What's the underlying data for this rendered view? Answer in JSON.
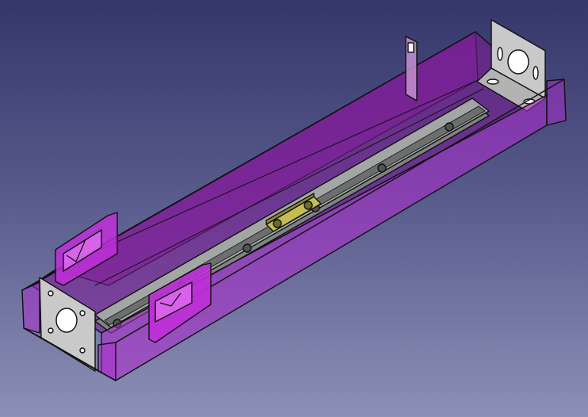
{
  "viewport": {
    "background_top": "#35366a",
    "background_bottom": "#8c8fb6"
  },
  "model": {
    "channel_color": "#9b1fb2",
    "bracket_color": "#c8c8c8",
    "rail_color": "#8e9190",
    "carriage_color": "#b8b24a",
    "edge_color": "#111111"
  }
}
